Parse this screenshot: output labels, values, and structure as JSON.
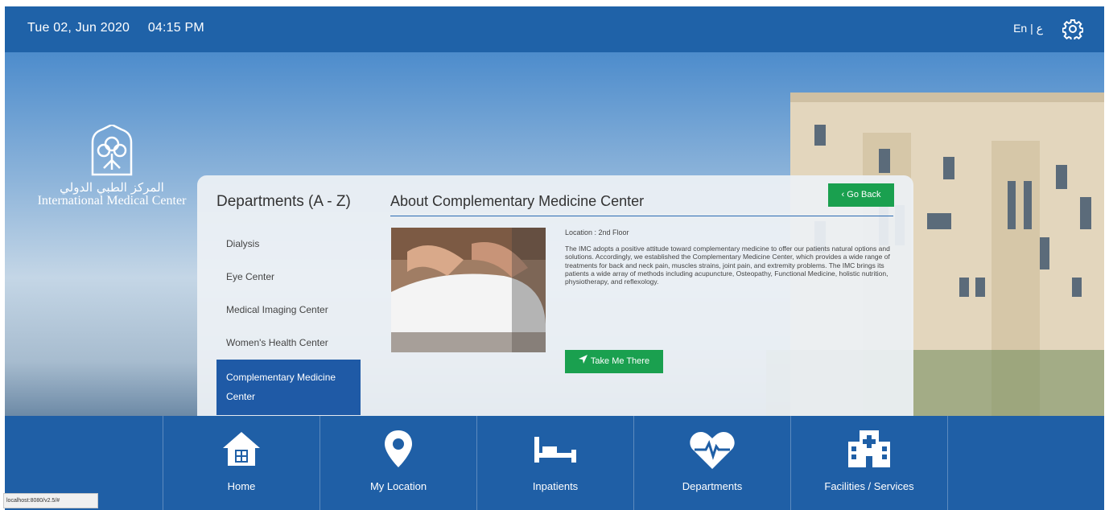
{
  "header": {
    "date": "Tue 02, Jun 2020",
    "time": "04:15 PM",
    "lang": "En | ع"
  },
  "logo": {
    "arabic": "المركز الطبي الدولي",
    "english": "International Medical Center"
  },
  "departments": {
    "title": "Departments (A - Z)",
    "items": [
      {
        "label": "Dialysis"
      },
      {
        "label": "Eye Center"
      },
      {
        "label": "Medical Imaging Center"
      },
      {
        "label": "Women's Health Center"
      },
      {
        "label": "Complementary Medicine Center"
      }
    ]
  },
  "about": {
    "title": "About Complementary Medicine Center",
    "go_back": "Go Back",
    "location": "Location : 2nd Floor",
    "description": "The IMC adopts a positive attitude toward complementary medicine to offer our patients natural options and solutions. Accordingly, we established the Complementary Medicine Center, which provides a wide range of treatments for back and neck pain, muscles strains, joint pain, and extremity problems. The IMC brings its patients a wide array of methods including acupuncture, Osteopathy, Functional Medicine, holistic nutrition, physiotherapy, and reflexology.",
    "take_me_there": "Take Me There"
  },
  "nav": {
    "home": "Home",
    "my_location": "My Location",
    "inpatients": "Inpatients",
    "departments": "Departments",
    "facilities": "Facilities / Services"
  },
  "status_url": "localhost:8080/v2.5/#",
  "colors": {
    "header": "#1f62a8",
    "footer": "#1f5fa6",
    "active": "#1f5aa6",
    "green": "#1aa04f"
  }
}
